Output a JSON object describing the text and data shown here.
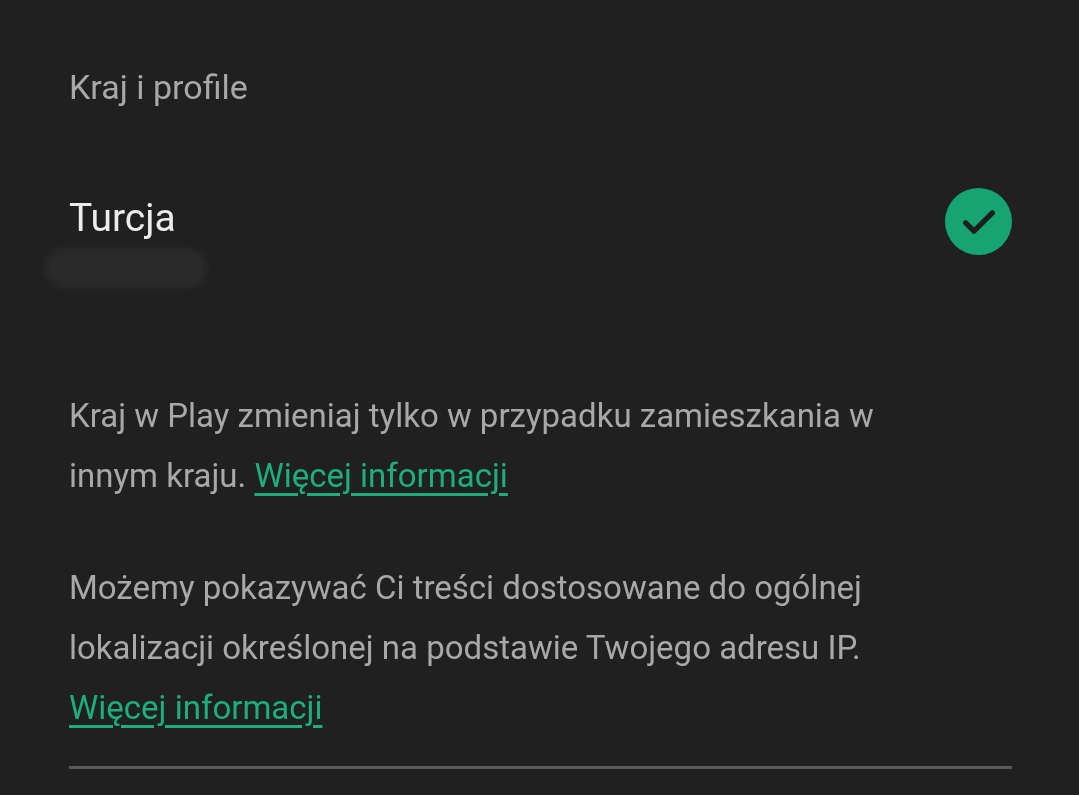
{
  "section_title": "Kraj i profile",
  "country": {
    "name": "Turcja",
    "selected": true
  },
  "notes": [
    {
      "text": "Kraj w Play zmieniaj tylko w przypadku zamieszkania w innym kraju.",
      "link": "Więcej informacji"
    },
    {
      "text": "Możemy pokazywać Ci treści dostosowane do ogólnej lokalizacji określonej na podstawie Twojego adresu IP.",
      "link": "Więcej informacji"
    }
  ]
}
